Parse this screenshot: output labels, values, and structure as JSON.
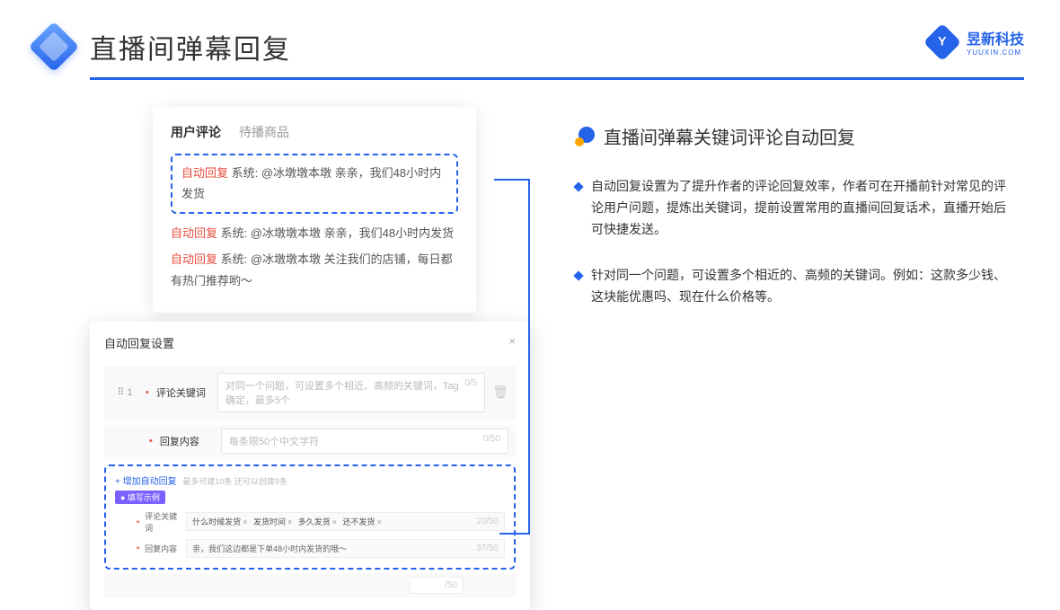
{
  "header": {
    "title": "直播间弹幕回复",
    "brand": "昱新科技",
    "brand_sub": "YUUXIN.COM"
  },
  "card1": {
    "tabs": {
      "active": "用户评论",
      "inactive": "待播商品"
    },
    "msg1": {
      "badge": "自动回复",
      "text": " 系统: @冰墩墩本墩 亲亲，我们48小时内发货"
    },
    "msg2": {
      "badge": "自动回复",
      "text": " 系统: @冰墩墩本墩 亲亲，我们48小时内发货"
    },
    "msg3": {
      "badge": "自动回复",
      "text": " 系统: @冰墩墩本墩 关注我们的店铺，每日都有热门推荐哟～"
    }
  },
  "card2": {
    "title": "自动回复设置",
    "close": "×",
    "idx": "1",
    "row1_label": "评论关键词",
    "row1_ph": "对同一个问题，可设置多个相近、高频的关键词，Tag确定，最多5个",
    "row1_cnt": "0/5",
    "row2_label": "回复内容",
    "row2_ph": "每条限50个中文字符",
    "row2_cnt": "0/50",
    "add": "+ 增加自动回复",
    "add_hint": "最多可建10条 还可以创建9条",
    "ex_badge": "● 填写示例",
    "ex1_label": "评论关键词",
    "ex1_tags": [
      "什么时候发货",
      "发货时间",
      "多久发货",
      "还不发货"
    ],
    "ex1_cnt": "20/50",
    "ex2_label": "回复内容",
    "ex2_val": "亲，我们这边都是下单48小时内发货的哦～",
    "ex2_cnt": "37/50",
    "below_cnt": "/50"
  },
  "right": {
    "title": "直播间弹幕关键词评论自动回复",
    "p1": "自动回复设置为了提升作者的评论回复效率，作者可在开播前针对常见的评论用户问题，提炼出关键词，提前设置常用的直播间回复话术，直播开始后可快捷发送。",
    "p2": "针对同一个问题，可设置多个相近的、高频的关键词。例如：这款多少钱、这块能优惠吗、现在什么价格等。"
  }
}
